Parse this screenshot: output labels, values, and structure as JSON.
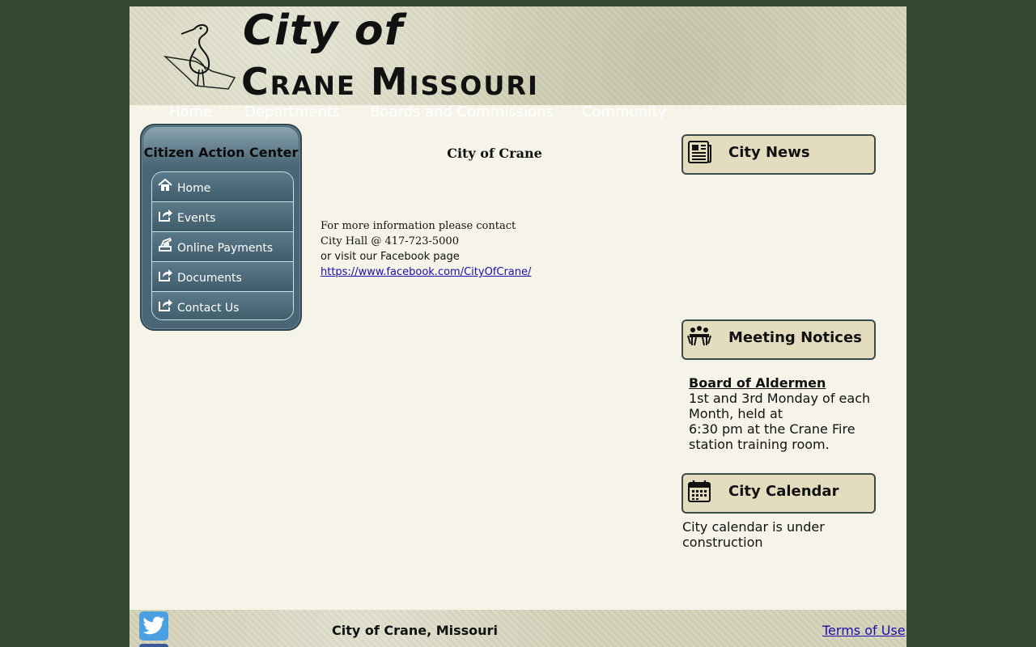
{
  "header": {
    "title_line1": "City of",
    "title_line2": "Crane Missouri"
  },
  "nav": {
    "items": [
      "Home",
      "Departments",
      "Boards and Commissions",
      "Community"
    ]
  },
  "action_center": {
    "title": "Citizen Action Center",
    "items": [
      {
        "label": "Home",
        "icon": "home-icon"
      },
      {
        "label": "Events",
        "icon": "share-arrow-icon"
      },
      {
        "label": "Online Payments",
        "icon": "payment-hand-icon"
      },
      {
        "label": "Documents",
        "icon": "share-arrow-icon"
      },
      {
        "label": "Contact Us",
        "icon": "share-arrow-icon"
      }
    ]
  },
  "main": {
    "title": "City of Crane",
    "contact_line1": "For more information please contact",
    "contact_line2": "City Hall @ 417-723-5000",
    "contact_line3": "or visit our Facebook page",
    "facebook_link": "https://www.facebook.com/CityOfCrane/"
  },
  "right": {
    "news_title": "City News",
    "meeting_title": "Meeting Notices",
    "meeting_heading": "Board of Aldermen",
    "meeting_body": "1st and 3rd Monday of each Month, held at",
    "meeting_body2": "6:30 pm at the Crane Fire station training room.",
    "calendar_title": "City Calendar",
    "calendar_text": "City calendar is under construction"
  },
  "footer": {
    "title": "City of Crane, Missouri",
    "terms": "Terms of Use"
  },
  "colors": {
    "background": "#344a34",
    "panel": "#4a6676",
    "box": "#e4dcbf",
    "link": "#1a0dab"
  }
}
